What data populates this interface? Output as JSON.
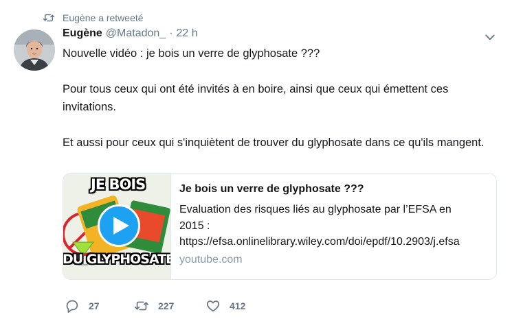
{
  "retweet_banner": {
    "text": "Eugène a retweeté",
    "icon": "retweet-icon"
  },
  "tweet": {
    "author_name": "Eugène",
    "handle": "@Matadon_",
    "separator": "·",
    "time": "22 h",
    "text": [
      "Nouvelle vidéo : je bois un verre de glyphosate ???",
      "Pour tous ceux qui ont été invités à en boire, ainsi que ceux qui émettent ces invitations.",
      "Et aussi pour ceux qui s'inquiètent de trouver du glyphosate dans ce qu'ils mangent."
    ]
  },
  "card": {
    "thumb_top_text": "JE BOIS",
    "thumb_bottom_text": "DU GLYPHOSATE ??",
    "title": "Je bois un verre de glyphosate ???",
    "description_line1": "Evaluation des risques liés au glyphosate par l’EFSA en",
    "description_line2": "2015 :",
    "description_url": "https://efsa.onlinelibrary.wiley.com/doi/epdf/10.2903/j.efsa",
    "domain": "youtube.com",
    "play_icon": "play-icon"
  },
  "actions": {
    "reply_count": "27",
    "retweet_count": "227",
    "like_count": "412"
  },
  "colors": {
    "text": "#14171a",
    "secondary": "#657786",
    "muted": "#8899a6",
    "accent": "#1da1f2",
    "border": "#e1e8ed"
  }
}
